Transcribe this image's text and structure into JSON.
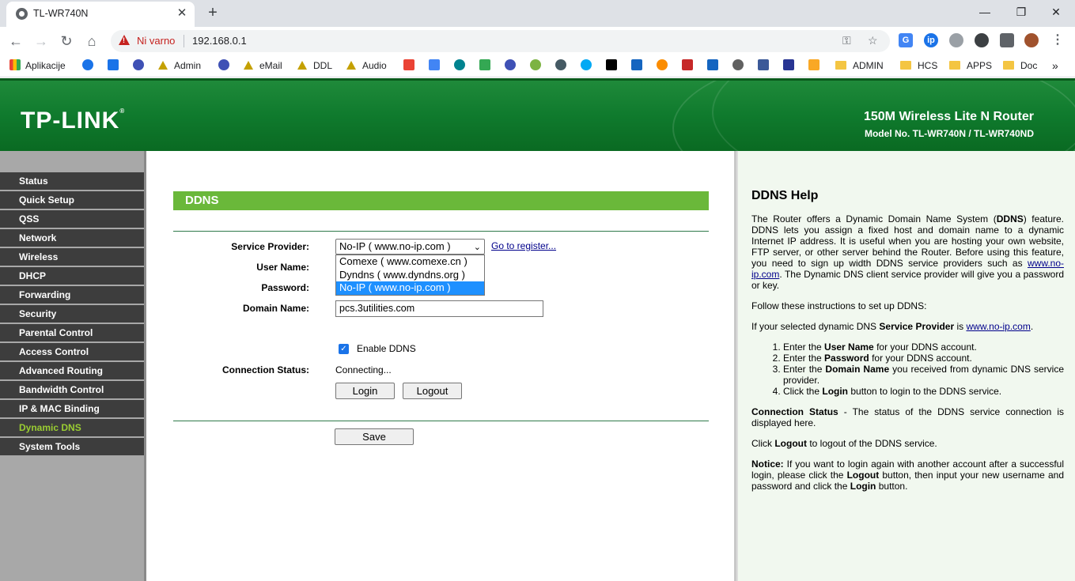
{
  "browser": {
    "tab_title": "TL-WR740N",
    "tab_close": "✕",
    "new_tab": "+",
    "not_secure": "Ni varno",
    "url": "192.168.0.1",
    "window": {
      "minimize": "—",
      "restore": "❐",
      "close": "✕"
    }
  },
  "bookmarks": [
    {
      "label": "Aplikacije",
      "icon": "apps-grid-icon"
    },
    {
      "label": "Admin",
      "icon": "triangle-icon"
    },
    {
      "label": "eMail",
      "icon": "triangle-icon"
    },
    {
      "label": "DDL",
      "icon": "triangle-icon"
    },
    {
      "label": "Audio",
      "icon": "triangle-icon"
    },
    {
      "label": "ADMIN",
      "icon": "folder-icon"
    },
    {
      "label": "HCS",
      "icon": "folder-icon"
    },
    {
      "label": "APPS",
      "icon": "folder-icon"
    },
    {
      "label": "Doc",
      "icon": "folder-icon"
    },
    {
      "label": "»",
      "icon": "more-icon"
    }
  ],
  "router": {
    "logo": "TP-LINK",
    "product": "150M Wireless Lite N Router",
    "model": "Model No. TL-WR740N / TL-WR740ND"
  },
  "menu": [
    "Status",
    "Quick Setup",
    "QSS",
    "Network",
    "Wireless",
    "DHCP",
    "Forwarding",
    "Security",
    "Parental Control",
    "Access Control",
    "Advanced Routing",
    "Bandwidth Control",
    "IP & MAC Binding",
    "Dynamic DNS",
    "System Tools"
  ],
  "menu_active": "Dynamic DNS",
  "form": {
    "section_title": "DDNS",
    "service_provider_label": "Service Provider:",
    "service_provider_value": "No-IP ( www.no-ip.com )",
    "go_register": "Go to register...",
    "options": [
      "Comexe ( www.comexe.cn )",
      "Dyndns ( www.dyndns.org )",
      "No-IP ( www.no-ip.com )"
    ],
    "username_label": "User Name:",
    "password_label": "Password:",
    "domain_label": "Domain Name:",
    "domain_value": "pcs.3utilities.com",
    "enable_label": "Enable DDNS",
    "enable_checked": true,
    "status_label": "Connection Status:",
    "status_value": "Connecting...",
    "login": "Login",
    "logout": "Logout",
    "save": "Save"
  },
  "help": {
    "title": "DDNS Help",
    "p1_a": "The Router offers a Dynamic Domain Name System (",
    "p1_b": "DDNS",
    "p1_c": ") feature. DDNS lets you assign a fixed host and domain name to a dynamic Internet IP address. It is useful when you are hosting your own website, FTP server, or other server behind the Router. Before using this feature, you need to sign up width DDNS service providers such as ",
    "p1_link": "www.no-ip.com",
    "p1_d": ". The Dynamic DNS client service provider will give you a password or key.",
    "p2": "Follow these instructions to set up DDNS:",
    "p3_a": "If your selected dynamic DNS ",
    "p3_b": "Service Provider",
    "p3_c": " is ",
    "p3_link": "www.no-ip.com",
    "p3_d": ".",
    "steps": [
      {
        "a": "Enter the ",
        "b": "User Name",
        "c": " for your DDNS account."
      },
      {
        "a": "Enter the ",
        "b": "Password",
        "c": " for your DDNS account."
      },
      {
        "a": "Enter the ",
        "b": "Domain Name",
        "c": " you received from dynamic DNS service provider."
      },
      {
        "a": "Click the ",
        "b": "Login",
        "c": " button to login to the DDNS service."
      }
    ],
    "p4_b": "Connection Status",
    "p4_c": " - The status of the DDNS service connection is displayed here.",
    "p5_a": "Click ",
    "p5_b": "Logout",
    "p5_c": " to logout of the DDNS service.",
    "p6_b": "Notice:",
    "p6_c": "  If you want to login again with another account after a successful login, please click the ",
    "p6_d": "Logout",
    "p6_e": " button, then input your new username and password and click the ",
    "p6_f": "Login",
    "p6_g": " button."
  },
  "colors": {
    "header_green": "#0f7a2d",
    "menu_bg": "#3d3d3d",
    "menu_active": "#9acd32",
    "section_green": "#6ab83a",
    "help_bg": "#f1f8ef"
  }
}
